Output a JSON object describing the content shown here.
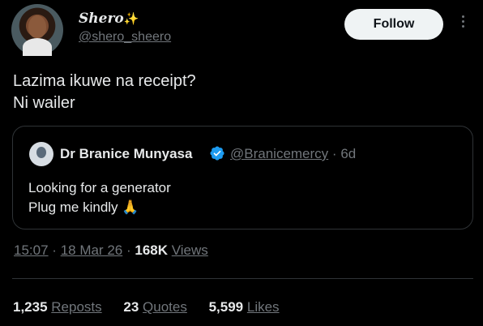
{
  "author": {
    "name": "Shero",
    "name_emoji": "✨",
    "handle": "@shero_sheero",
    "follow_label": "Follow"
  },
  "tweet": {
    "line1": "Lazima ikuwe na receipt?",
    "line2": "Ni wailer"
  },
  "quoted": {
    "name": "Dr Branice Munyasa",
    "handle": "@Branicemercy",
    "separator": "·",
    "age": "6d",
    "line1": "Looking for a generator",
    "line2": "Plug me kindly",
    "line2_emoji": "🙏"
  },
  "meta": {
    "time": "15:07",
    "sep1": "·",
    "date": "18 Mar 26",
    "sep2": "·",
    "views_count": "168K",
    "views_label": "Views"
  },
  "stats": {
    "reposts_count": "1,235",
    "reposts_label": "Reposts",
    "quotes_count": "23",
    "quotes_label": "Quotes",
    "likes_count": "5,599",
    "likes_label": "Likes"
  },
  "colors": {
    "background": "#000000",
    "text": "#e7e9ea",
    "muted": "#71767b",
    "verified": "#1d9bf0"
  }
}
